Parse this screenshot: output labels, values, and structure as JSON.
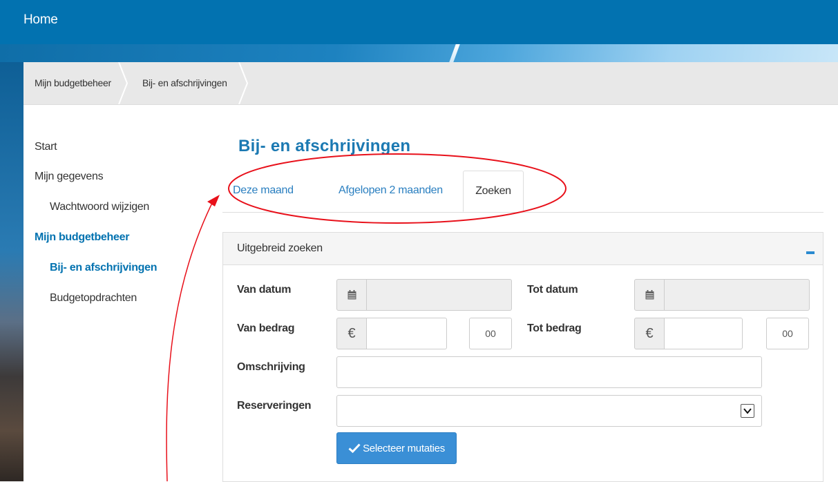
{
  "header": {
    "title": "Home"
  },
  "breadcrumb": [
    {
      "label": "Mijn budgetbeheer"
    },
    {
      "label": "Bij- en afschrijvingen"
    }
  ],
  "sidenav": {
    "items": [
      {
        "label": "Start"
      },
      {
        "label": "Mijn gegevens"
      },
      {
        "label": "Wachtwoord wijzigen"
      },
      {
        "label": "Mijn budgetbeheer"
      },
      {
        "label": "Bij- en afschrijvingen"
      },
      {
        "label": "Budgetopdrachten"
      }
    ]
  },
  "page": {
    "title": "Bij- en afschrijvingen"
  },
  "tabs": [
    {
      "label": "Deze maand"
    },
    {
      "label": "Afgelopen 2 maanden"
    },
    {
      "label": "Zoeken",
      "active": true
    }
  ],
  "search_panel": {
    "title": "Uitgebreid zoeken",
    "van_datum_label": "Van datum",
    "tot_datum_label": "Tot datum",
    "van_bedrag_label": "Van bedrag",
    "tot_bedrag_label": "Tot bedrag",
    "currency_symbol": "€",
    "cents_placeholder": "00",
    "omschrijving_label": "Omschrijving",
    "reserveringen_label": "Reserveringen",
    "submit_label": "Selecteer mutaties"
  },
  "colors": {
    "brand_blue": "#0272b0",
    "link_blue": "#2a7fc0",
    "button_blue": "#3a8fd6",
    "annotation_red": "#e8101a"
  }
}
